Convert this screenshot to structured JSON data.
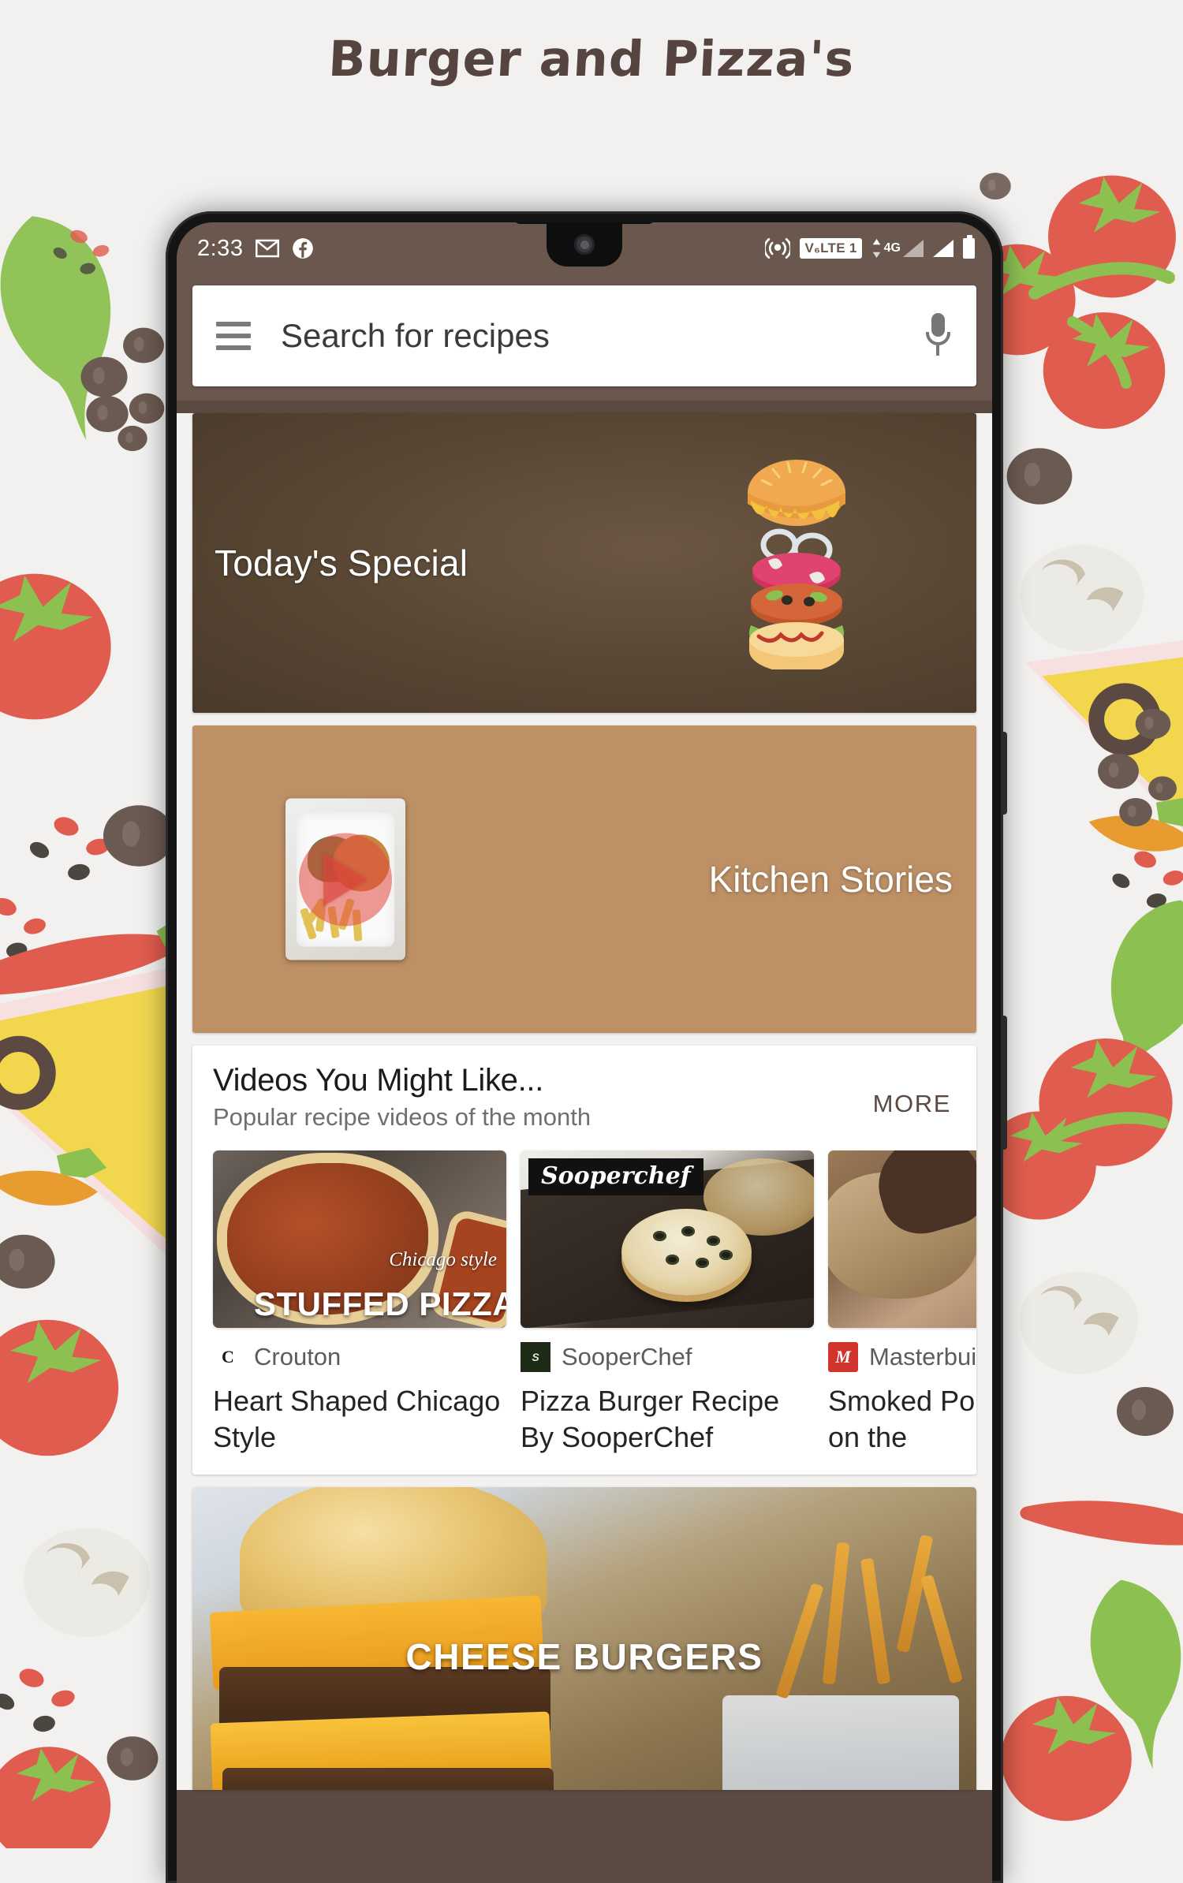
{
  "page": {
    "title": "Burger and Pizza's",
    "title_color": "#554440",
    "background_color": "#f2f1ef"
  },
  "phone": {
    "statusbar": {
      "time": "2:33",
      "left_icons": [
        "gmail-icon",
        "facebook-icon"
      ],
      "hotspot_icon": "hotspot-icon",
      "volte_label": "V₆LTE 1",
      "network_label": "4G",
      "signal_icons": [
        "signal-bars-1",
        "signal-bars-2"
      ],
      "battery_icon": "battery-icon",
      "background_color": "#6a574d"
    },
    "search": {
      "menu_icon": "hamburger-menu-icon",
      "placeholder": "Search for recipes",
      "value": "",
      "mic_icon": "microphone-icon"
    },
    "todays_special": {
      "label": "Today's Special",
      "image_alt": "exploded-burger-illustration"
    },
    "kitchen_stories": {
      "label": "Kitchen Stories",
      "play_icon": "play-button-icon",
      "thumb_alt": "burger-and-fries-on-white-plate"
    },
    "videos_section": {
      "title": "Videos You Might Like...",
      "subtitle": "Popular recipe videos of the month",
      "more_label": "MORE",
      "cards": [
        {
          "channel": "Crouton",
          "channel_initial": "C",
          "channel_color": "#ffffff",
          "channel_text_color": "#1b1b1b",
          "title": "Heart Shaped Chicago Style",
          "thumb_overlay_script": "Chicago style",
          "thumb_overlay_main": "STUFFED PIZZA",
          "thumb_alt": "chicago-style-stuffed-pizza"
        },
        {
          "channel": "SooperChef",
          "channel_initial": "S",
          "channel_color": "#1e2b17",
          "channel_text_color": "#ffffff",
          "title": "Pizza Burger Recipe By SooperChef",
          "thumb_overlay_main": "Sooperchef",
          "thumb_alt": "pizza-burger-on-dark-board"
        },
        {
          "channel": "Masterbuilt",
          "channel_initial": "M",
          "channel_color": "#d0342c",
          "channel_text_color": "#ffffff",
          "title": "Smoked Pork Bombs on the",
          "thumb_alt": "smoked-pork-bombs-with-sauce"
        }
      ]
    },
    "cheese_burgers": {
      "label": "CHEESE BURGERS",
      "image_alt": "stacked-cheeseburger-with-fries"
    }
  },
  "decoration": {
    "alt": "flat-illustrated-food-pattern",
    "items": [
      "basil-leaf",
      "tomato",
      "cherry-tomatoes",
      "olive",
      "mushroom",
      "chili-pepper",
      "pizza-slice",
      "pepper-flakes"
    ],
    "colors": {
      "tomato": "#e05c4e",
      "leaf": "#8cc152",
      "olive": "#6b5a52",
      "mushroom": "#e9e6df",
      "pizza_crust": "#f2d74e",
      "pizza_base": "#f7e0e0"
    }
  }
}
